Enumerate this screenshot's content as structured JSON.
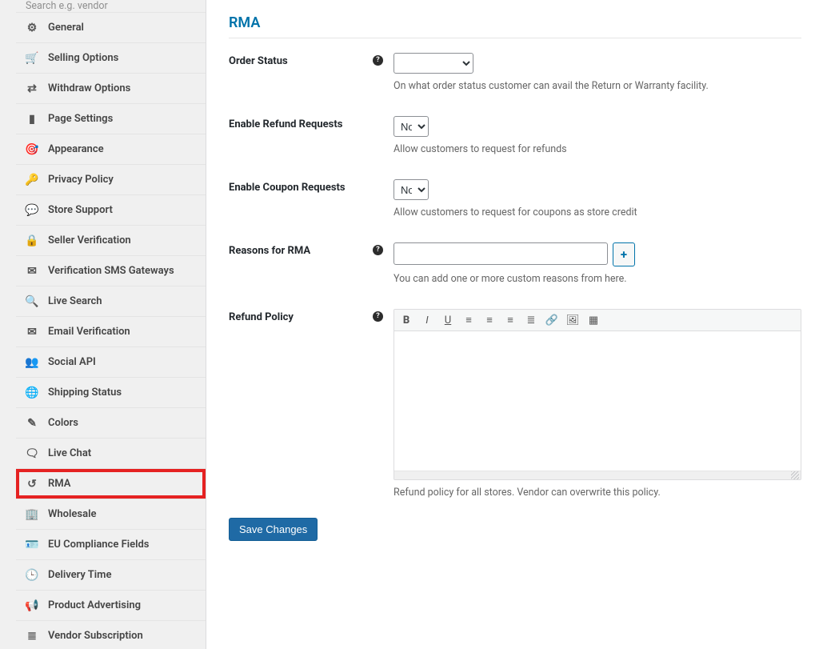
{
  "search": {
    "placeholder": "Search e.g. vendor"
  },
  "sidebar": {
    "items": [
      {
        "name": "general",
        "label": "General",
        "icon_char": "⚙",
        "icon_name": "gear-icon",
        "color": "c-blue"
      },
      {
        "name": "selling-options",
        "label": "Selling Options",
        "icon_char": "🛒",
        "icon_name": "cart-icon",
        "color": "c-blue"
      },
      {
        "name": "withdraw-options",
        "label": "Withdraw Options",
        "icon_char": "⇄",
        "icon_name": "transfer-icon",
        "color": "c-orange"
      },
      {
        "name": "page-settings",
        "label": "Page Settings",
        "icon_char": "▮",
        "icon_name": "page-icon",
        "color": "c-purple"
      },
      {
        "name": "appearance",
        "label": "Appearance",
        "icon_char": "🎯",
        "icon_name": "pin-icon",
        "color": "c-blue"
      },
      {
        "name": "privacy-policy",
        "label": "Privacy Policy",
        "icon_char": "🔑",
        "icon_name": "key-icon",
        "color": "c-gray"
      },
      {
        "name": "store-support",
        "label": "Store Support",
        "icon_char": "💬",
        "icon_name": "chat-icon",
        "color": "c-gray"
      },
      {
        "name": "seller-verification",
        "label": "Seller Verification",
        "icon_char": "🔒",
        "icon_name": "lock-icon",
        "color": "c-gray"
      },
      {
        "name": "verification-sms-gateways",
        "label": "Verification SMS Gateways",
        "icon_char": "✉",
        "icon_name": "mail-icon",
        "color": "c-gray"
      },
      {
        "name": "live-search",
        "label": "Live Search",
        "icon_char": "🔍",
        "icon_name": "search-icon",
        "color": "c-gray"
      },
      {
        "name": "email-verification",
        "label": "Email Verification",
        "icon_char": "✉",
        "icon_name": "envelope-icon",
        "color": "c-gray"
      },
      {
        "name": "social-api",
        "label": "Social API",
        "icon_char": "👥",
        "icon_name": "people-icon",
        "color": "c-green"
      },
      {
        "name": "shipping-status",
        "label": "Shipping Status",
        "icon_char": "🌐",
        "icon_name": "globe-icon",
        "color": "c-gray"
      },
      {
        "name": "colors",
        "label": "Colors",
        "icon_char": "✎",
        "icon_name": "brush-icon",
        "color": "c-gray"
      },
      {
        "name": "live-chat",
        "label": "Live Chat",
        "icon_char": "🗨",
        "icon_name": "bubble-icon",
        "color": "c-gray"
      },
      {
        "name": "rma",
        "label": "RMA",
        "icon_char": "↺",
        "icon_name": "undo-icon",
        "color": "c-gray",
        "highlight": true
      },
      {
        "name": "wholesale",
        "label": "Wholesale",
        "icon_char": "🏢",
        "icon_name": "building-icon",
        "color": "c-gray"
      },
      {
        "name": "eu-compliance-fields",
        "label": "EU Compliance Fields",
        "icon_char": "🪪",
        "icon_name": "id-icon",
        "color": "c-gray"
      },
      {
        "name": "delivery-time",
        "label": "Delivery Time",
        "icon_char": "🕒",
        "icon_name": "clock-icon",
        "color": "c-gray"
      },
      {
        "name": "product-advertising",
        "label": "Product Advertising",
        "icon_char": "📢",
        "icon_name": "megaphone-icon",
        "color": "c-gray"
      },
      {
        "name": "vendor-subscription",
        "label": "Vendor Subscription",
        "icon_char": "≣",
        "icon_name": "list-icon",
        "color": "c-gray"
      }
    ]
  },
  "page": {
    "title": "RMA",
    "save_label": "Save Changes"
  },
  "form": {
    "order_status": {
      "label": "Order Status",
      "hint": "On what order status customer can avail the Return or Warranty facility.",
      "value": ""
    },
    "enable_refund_requests": {
      "label": "Enable Refund Requests",
      "hint": "Allow customers to request for refunds",
      "value": "No"
    },
    "enable_coupon_requests": {
      "label": "Enable Coupon Requests",
      "hint": "Allow customers to request for coupons as store credit",
      "value": "No"
    },
    "reasons_for_rma": {
      "label": "Reasons for RMA",
      "hint": "You can add one or more custom reasons from here.",
      "value": "",
      "add_label": "+"
    },
    "refund_policy": {
      "label": "Refund Policy",
      "hint": "Refund policy for all stores. Vendor can overwrite this policy.",
      "value": ""
    }
  },
  "editor_tools": [
    {
      "name": "bold-icon",
      "char": "B"
    },
    {
      "name": "italic-icon",
      "char": "I"
    },
    {
      "name": "underline-icon",
      "char": "U"
    },
    {
      "name": "align-left-icon",
      "char": "≡"
    },
    {
      "name": "align-center-icon",
      "char": "≡"
    },
    {
      "name": "align-right-icon",
      "char": "≡"
    },
    {
      "name": "align-justify-icon",
      "char": "≣"
    },
    {
      "name": "link-icon",
      "char": "🔗"
    },
    {
      "name": "image-icon",
      "char": "🖼"
    },
    {
      "name": "fullscreen-icon",
      "char": "▦"
    }
  ]
}
